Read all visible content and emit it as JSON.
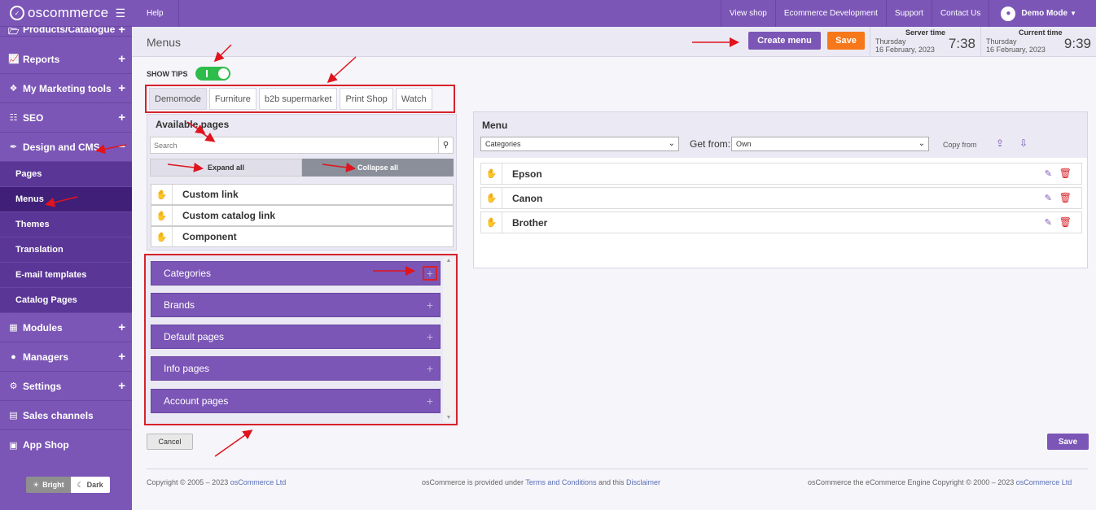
{
  "brand": {
    "name": "oscommerce",
    "logo_mark": "✓"
  },
  "sidebar": {
    "items": [
      {
        "label": "Products/Catalogue",
        "icon": "folder-icon"
      },
      {
        "label": "Reports",
        "icon": "chart-icon"
      },
      {
        "label": "My Marketing tools",
        "icon": "tag-icon"
      },
      {
        "label": "SEO",
        "icon": "sitemap-icon"
      },
      {
        "label": "Design and CMS",
        "icon": "brush-icon"
      }
    ],
    "sub_items": [
      "Pages",
      "Menus",
      "Themes",
      "Translation",
      "E-mail templates",
      "Catalog Pages"
    ],
    "items_after": [
      {
        "label": "Modules",
        "icon": "puzzle-icon"
      },
      {
        "label": "Managers",
        "icon": "user-icon"
      },
      {
        "label": "Settings",
        "icon": "gears-icon"
      },
      {
        "label": "Sales channels",
        "icon": "monitor-icon"
      },
      {
        "label": "App Shop",
        "icon": "cart-icon"
      }
    ],
    "theme": {
      "bright": "Bright",
      "dark": "Dark"
    }
  },
  "topbar": {
    "help": "Help",
    "links": [
      "View shop",
      "Ecommerce Development",
      "Support",
      "Contact Us"
    ],
    "user": "Demo Mode"
  },
  "header": {
    "title": "Menus",
    "create_menu": "Create menu",
    "save": "Save",
    "server_time": {
      "label": "Server time",
      "day": "Thursday",
      "date": "16 February, 2023",
      "time": "7:38"
    },
    "current_time": {
      "label": "Current time",
      "day": "Thursday",
      "date": "16 February, 2023",
      "time": "9:39"
    }
  },
  "tips": {
    "label": "SHOW TIPS",
    "enabled": true
  },
  "tabs": [
    "Demomode",
    "Furniture",
    "b2b supermarket",
    "Print Shop",
    "Watch"
  ],
  "available": {
    "title": "Available pages",
    "search_placeholder": "Search",
    "expand_all": "Expand all",
    "collapse_all": "Collapse all",
    "links": [
      "Custom link",
      "Custom catalog link",
      "Component"
    ],
    "groups": [
      "Categories",
      "Brands",
      "Default pages",
      "Info pages",
      "Account pages"
    ]
  },
  "menu": {
    "title": "Menu",
    "type_value": "Categories",
    "get_from_label": "Get from:",
    "get_from_value": "Own",
    "copy_from": "Copy from",
    "items": [
      "Epson",
      "Canon",
      "Brother"
    ]
  },
  "actions": {
    "cancel": "Cancel",
    "save": "Save"
  },
  "footer": {
    "copyright_prefix": "Copyright © 2005 – 2023 ",
    "copyright_link": "osCommerce Ltd",
    "middle_prefix": "osCommerce is provided under ",
    "terms": "Terms and Conditions",
    "middle_and": " and this ",
    "disclaimer": "Disclaimer",
    "right": "osCommerce the eCommerce Engine Copyright © 2000 – 2023 ",
    "right_link": "osCommerce Ltd"
  },
  "colors": {
    "purple": "#7b56b6",
    "orange": "#f7781a",
    "green": "#2ebd4a",
    "red": "#d6222a"
  }
}
